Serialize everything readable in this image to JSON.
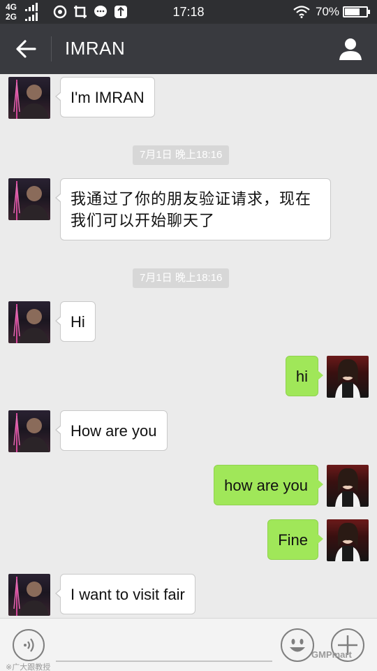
{
  "status_bar": {
    "network_top": "4G",
    "network_bottom": "2G",
    "time": "17:18",
    "battery_text": "70%",
    "battery_level": 0.7,
    "icons": [
      "vpn-icon",
      "screenshot-icon",
      "chat-notification-icon",
      "shield-icon"
    ]
  },
  "header": {
    "title": "IMRAN",
    "back_icon": "arrow-left-icon",
    "profile_icon": "person-icon",
    "background": "#393a3f"
  },
  "messages": [
    {
      "side": "left",
      "text": "I'm IMRAN"
    },
    {
      "side": "left",
      "text": "我通过了你的朋友验证请求，现在我们可以开始聊天了"
    },
    {
      "side": "left",
      "text": "Hi"
    },
    {
      "side": "right",
      "text": "hi"
    },
    {
      "side": "left",
      "text": "How are you"
    },
    {
      "side": "right",
      "text": "how are you"
    },
    {
      "side": "right",
      "text": "Fine"
    },
    {
      "side": "left",
      "text": "I want to visit fair"
    }
  ],
  "timestamps": [
    "7月1日 晚上18:16",
    "7月1日 晚上18:16"
  ],
  "colors": {
    "outgoing_bubble": "#a0e759",
    "incoming_bubble": "#ffffff",
    "chat_background": "#ebebeb",
    "status_bar": "#2e2f32"
  },
  "input_bar": {
    "voice_icon": "voice-icon",
    "emoji_icon": "smiley-icon",
    "more_icon": "plus-icon"
  },
  "watermarks": {
    "left": "※广大跟教授",
    "right": "GMPmart"
  }
}
